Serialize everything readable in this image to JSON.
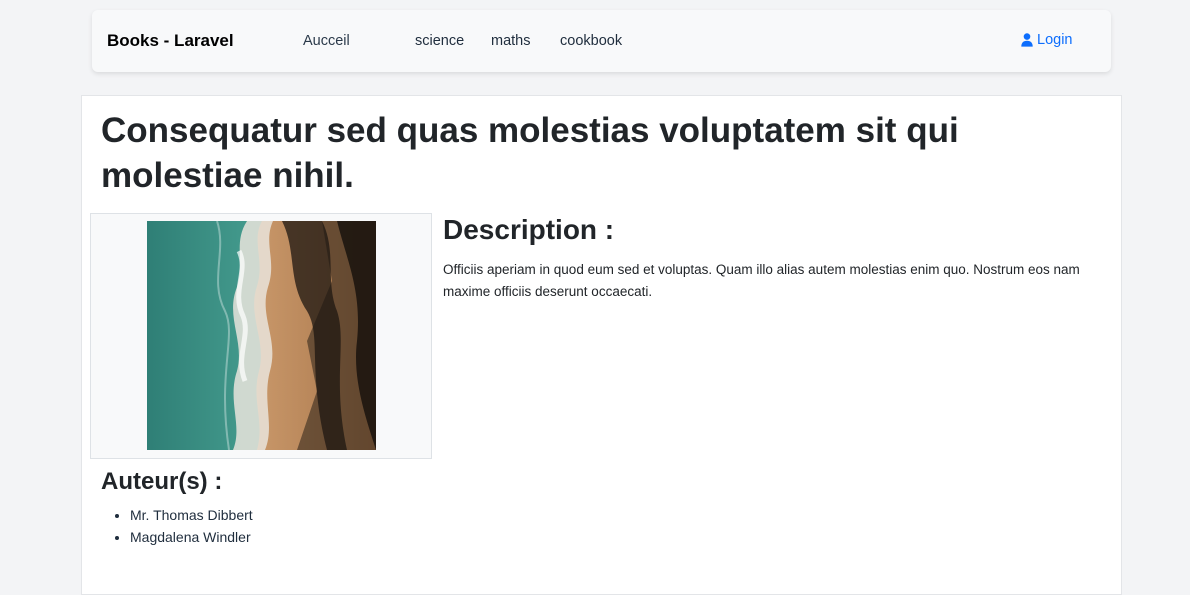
{
  "navbar": {
    "brand": "Books - Laravel",
    "links": [
      {
        "label": "Aucceil"
      },
      {
        "label": "science"
      },
      {
        "label": "maths"
      },
      {
        "label": "cookbook"
      }
    ],
    "login_label": "Login",
    "login_icon": "user-icon",
    "accent_color": "#0d6efd"
  },
  "book": {
    "title": "Consequatur sed quas molestias voluptatem sit qui molestiae nihil.",
    "image_description": "aerial-beach-photo",
    "description_heading": "Description :",
    "description": "Officiis aperiam in quod eum sed et voluptas. Quam illo alias autem molestias enim quo. Nostrum eos nam maxime officiis deserunt occaecati.",
    "authors_heading": "Auteur(s) :",
    "authors": [
      {
        "name": "Mr. Thomas Dibbert"
      },
      {
        "name": "Magdalena Windler"
      }
    ]
  }
}
